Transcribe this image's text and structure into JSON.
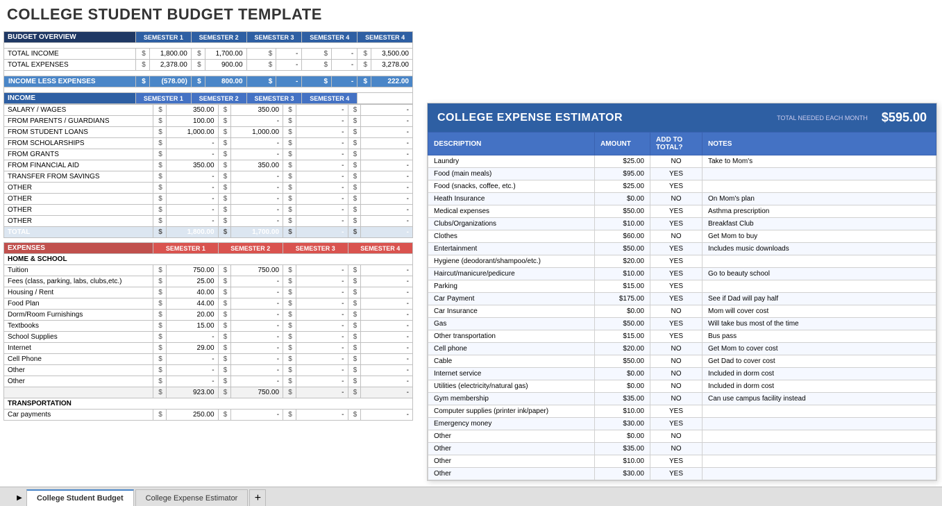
{
  "title": "COLLEGE STUDENT BUDGET TEMPLATE",
  "budget_overview": {
    "header": "BUDGET OVERVIEW",
    "columns": [
      "SEMESTER 1",
      "SEMESTER 2",
      "SEMESTER 3",
      "SEMESTER 4",
      "SEMESTER 4"
    ],
    "total_income": {
      "label": "TOTAL INCOME",
      "s1": "1,800.00",
      "s2": "1,700.00",
      "s3": "-",
      "s4": "-",
      "s5": "3,500.00"
    },
    "total_expenses": {
      "label": "TOTAL EXPENSES",
      "s1": "2,378.00",
      "s2": "900.00",
      "s3": "-",
      "s4": "-",
      "s5": "3,278.00"
    },
    "income_less": {
      "label": "INCOME LESS EXPENSES",
      "s1": "(578.00)",
      "s2": "800.00",
      "s3": "-",
      "s4": "-",
      "s5": "222.00"
    }
  },
  "income": {
    "header": "INCOME",
    "columns": [
      "SEMESTER 1",
      "SEMESTER 2",
      "SEMESTER 3",
      "SEMESTER 4"
    ],
    "rows": [
      {
        "label": "SALARY / WAGES",
        "s1": "350.00",
        "s2": "350.00",
        "s3": "-",
        "s4": "-"
      },
      {
        "label": "FROM PARENTS / GUARDIANS",
        "s1": "100.00",
        "s2": "-",
        "s3": "-",
        "s4": "-"
      },
      {
        "label": "FROM STUDENT LOANS",
        "s1": "1,000.00",
        "s2": "1,000.00",
        "s3": "-",
        "s4": "-"
      },
      {
        "label": "FROM SCHOLARSHIPS",
        "s1": "-",
        "s2": "-",
        "s3": "-",
        "s4": "-"
      },
      {
        "label": "FROM GRANTS",
        "s1": "-",
        "s2": "-",
        "s3": "-",
        "s4": "-"
      },
      {
        "label": "FROM FINANCIAL AID",
        "s1": "350.00",
        "s2": "350.00",
        "s3": "-",
        "s4": "-"
      },
      {
        "label": "TRANSFER FROM SAVINGS",
        "s1": "-",
        "s2": "-",
        "s3": "-",
        "s4": "-"
      },
      {
        "label": "OTHER",
        "s1": "-",
        "s2": "-",
        "s3": "-",
        "s4": "-"
      },
      {
        "label": "OTHER",
        "s1": "-",
        "s2": "-",
        "s3": "-",
        "s4": "-"
      },
      {
        "label": "OTHER",
        "s1": "-",
        "s2": "-",
        "s3": "-",
        "s4": "-"
      },
      {
        "label": "OTHER",
        "s1": "-",
        "s2": "-",
        "s3": "-",
        "s4": "-"
      }
    ],
    "total": {
      "label": "TOTAL",
      "s1": "1,800.00",
      "s2": "1,700.00",
      "s3": "-",
      "s4": "-"
    }
  },
  "expenses": {
    "header": "EXPENSES",
    "columns": [
      "SEMESTER 1",
      "SEMESTER 2",
      "SEMESTER 3",
      "SEMESTER 4"
    ],
    "home_school": {
      "label": "HOME & SCHOOL",
      "rows": [
        {
          "label": "Tuition",
          "s1": "750.00",
          "s2": "750.00",
          "s3": "-",
          "s4": "-"
        },
        {
          "label": "Fees (class, parking, labs, clubs,etc.)",
          "s1": "25.00",
          "s2": "-",
          "s3": "-",
          "s4": "-"
        },
        {
          "label": "Housing / Rent",
          "s1": "40.00",
          "s2": "-",
          "s3": "-",
          "s4": "-"
        },
        {
          "label": "Food Plan",
          "s1": "44.00",
          "s2": "-",
          "s3": "-",
          "s4": "-"
        },
        {
          "label": "Dorm/Room Furnishings",
          "s1": "20.00",
          "s2": "-",
          "s3": "-",
          "s4": "-"
        },
        {
          "label": "Textbooks",
          "s1": "15.00",
          "s2": "-",
          "s3": "-",
          "s4": "-"
        },
        {
          "label": "School Supplies",
          "s1": "-",
          "s2": "-",
          "s3": "-",
          "s4": "-"
        },
        {
          "label": "Internet",
          "s1": "29.00",
          "s2": "-",
          "s3": "-",
          "s4": "-"
        },
        {
          "label": "Cell Phone",
          "s1": "-",
          "s2": "-",
          "s3": "-",
          "s4": "-"
        },
        {
          "label": "Other",
          "s1": "-",
          "s2": "-",
          "s3": "-",
          "s4": "-"
        },
        {
          "label": "Other",
          "s1": "-",
          "s2": "-",
          "s3": "-",
          "s4": "-"
        }
      ],
      "subtotal": {
        "s1": "923.00",
        "s2": "750.00",
        "s3": "-",
        "s4": "-"
      }
    },
    "transportation": {
      "label": "TRANSPORTATION",
      "rows": [
        {
          "label": "Car payments",
          "s1": "250.00",
          "s2": "-",
          "s3": "-",
          "s4": "-"
        }
      ]
    }
  },
  "estimator": {
    "title": "COLLEGE EXPENSE ESTIMATOR",
    "total_label": "TOTAL NEEDED EACH MONTH",
    "total_amount": "$595.00",
    "col_description": "DESCRIPTION",
    "col_amount": "AMOUNT",
    "col_addto": "ADD TO TOTAL?",
    "col_notes": "NOTES",
    "rows": [
      {
        "description": "Laundry",
        "amount": "$25.00",
        "addto": "NO",
        "notes": "Take to Mom's"
      },
      {
        "description": "Food (main meals)",
        "amount": "$95.00",
        "addto": "YES",
        "notes": ""
      },
      {
        "description": "Food (snacks, coffee, etc.)",
        "amount": "$25.00",
        "addto": "YES",
        "notes": ""
      },
      {
        "description": "Heath Insurance",
        "amount": "$0.00",
        "addto": "NO",
        "notes": "On Mom's plan"
      },
      {
        "description": "Medical expenses",
        "amount": "$50.00",
        "addto": "YES",
        "notes": "Asthma prescription"
      },
      {
        "description": "Clubs/Organizations",
        "amount": "$10.00",
        "addto": "YES",
        "notes": "Breakfast Club"
      },
      {
        "description": "Clothes",
        "amount": "$60.00",
        "addto": "NO",
        "notes": "Get Mom to buy"
      },
      {
        "description": "Entertainment",
        "amount": "$50.00",
        "addto": "YES",
        "notes": "Includes music downloads"
      },
      {
        "description": "Hygiene (deodorant/shampoo/etc.)",
        "amount": "$20.00",
        "addto": "YES",
        "notes": ""
      },
      {
        "description": "Haircut/manicure/pedicure",
        "amount": "$10.00",
        "addto": "YES",
        "notes": "Go to beauty school"
      },
      {
        "description": "Parking",
        "amount": "$15.00",
        "addto": "YES",
        "notes": ""
      },
      {
        "description": "Car Payment",
        "amount": "$175.00",
        "addto": "YES",
        "notes": "See if Dad will pay half"
      },
      {
        "description": "Car Insurance",
        "amount": "$0.00",
        "addto": "NO",
        "notes": "Mom will cover cost"
      },
      {
        "description": "Gas",
        "amount": "$50.00",
        "addto": "YES",
        "notes": "Will take bus most of the time"
      },
      {
        "description": "Other transportation",
        "amount": "$15.00",
        "addto": "YES",
        "notes": "Bus pass"
      },
      {
        "description": "Cell phone",
        "amount": "$20.00",
        "addto": "NO",
        "notes": "Get Mom to cover cost"
      },
      {
        "description": "Cable",
        "amount": "$50.00",
        "addto": "NO",
        "notes": "Get Dad to cover cost"
      },
      {
        "description": "Internet service",
        "amount": "$0.00",
        "addto": "NO",
        "notes": "Included in dorm cost"
      },
      {
        "description": "Utilities (electricity/natural gas)",
        "amount": "$0.00",
        "addto": "NO",
        "notes": "Included in dorm cost"
      },
      {
        "description": "Gym membership",
        "amount": "$35.00",
        "addto": "NO",
        "notes": "Can use campus facility instead"
      },
      {
        "description": "Computer supplies (printer ink/paper)",
        "amount": "$10.00",
        "addto": "YES",
        "notes": ""
      },
      {
        "description": "Emergency money",
        "amount": "$30.00",
        "addto": "YES",
        "notes": ""
      },
      {
        "description": "Other",
        "amount": "$0.00",
        "addto": "NO",
        "notes": ""
      },
      {
        "description": "Other",
        "amount": "$35.00",
        "addto": "NO",
        "notes": ""
      },
      {
        "description": "Other",
        "amount": "$10.00",
        "addto": "YES",
        "notes": ""
      },
      {
        "description": "Other",
        "amount": "$30.00",
        "addto": "YES",
        "notes": ""
      }
    ]
  },
  "tabs": [
    {
      "label": "College Student Budget",
      "active": true
    },
    {
      "label": "College Expense Estimator",
      "active": false
    }
  ]
}
